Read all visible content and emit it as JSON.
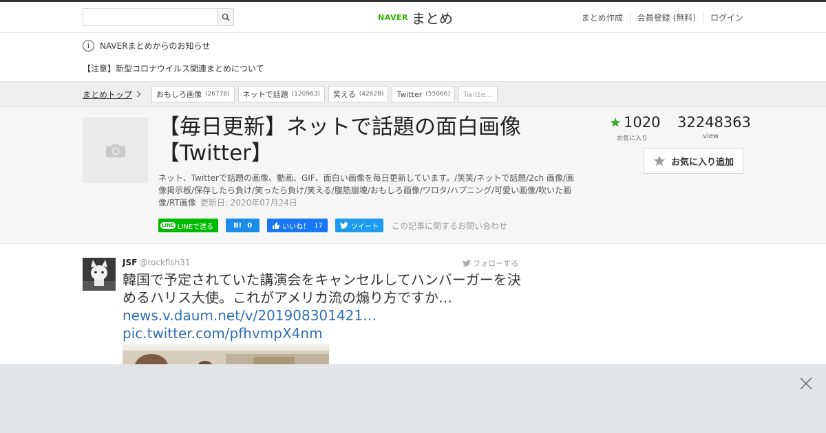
{
  "header": {
    "search_placeholder": "",
    "logo_naver": "NAVER",
    "logo_matome": "まとめ",
    "links": [
      "まとめ作成",
      "会員登録 (無料)",
      "ログイン"
    ]
  },
  "notice": {
    "title": "NAVERまとめからのお知らせ",
    "link": "【注意】新型コロナウイルス関連まとめについて"
  },
  "breadcrumb": {
    "top": "まとめトップ",
    "tags": [
      {
        "label": "おもしろ画像",
        "count": "(26778)"
      },
      {
        "label": "ネットで話題",
        "count": "(120963)"
      },
      {
        "label": "笑える",
        "count": "(42628)"
      },
      {
        "label": "Twitter",
        "count": "(55066)"
      },
      {
        "label": "Twitte…",
        "count": ""
      }
    ]
  },
  "article": {
    "title_line1": "【毎日更新】ネットで話題の面白画像",
    "title_line2": "【Twitter】",
    "description": "ネット、Twitterで話題の画像、動画、GIF、面白い画像を毎日更新しています。/笑笑/ネットで話題/2ch 画像/画像掲示板/保存したら負け/笑ったら負け/笑える/腹筋崩壊/おもしろ画像/ワロタ/ハプニング/可愛い画像/吹いた画像/RT画像",
    "updated": "更新日: 2020年07月24日",
    "favorites": "1020",
    "favorites_label": "お気に入り",
    "views": "32248363",
    "views_label": "view",
    "fav_button": "お気に入り追加"
  },
  "share": {
    "line": "LINEで送る",
    "line_badge": "LINE",
    "hatena_icon": "B!",
    "hatena_count": "0",
    "facebook": "いいね！",
    "facebook_count": "17",
    "twitter": "ツイート",
    "contact": "この記事に関するお問い合わせ"
  },
  "tweet": {
    "name": "JSF",
    "handle": "@rockfish31",
    "follow": "フォローする",
    "text": "韓国で予定されていた講演会をキャンセルしてハンバーガーを決めるハリス大使。これがアメリカ流の煽り方ですか…",
    "link1": "news.v.daum.net/v/201908301421…",
    "link2": "pic.twitter.com/pfhvmpX4nm"
  },
  "colors": {
    "naver_green": "#2db400",
    "star_green": "#3aa935",
    "link_blue": "#2f6db5",
    "ad_overlay": "#e2e5e8"
  }
}
